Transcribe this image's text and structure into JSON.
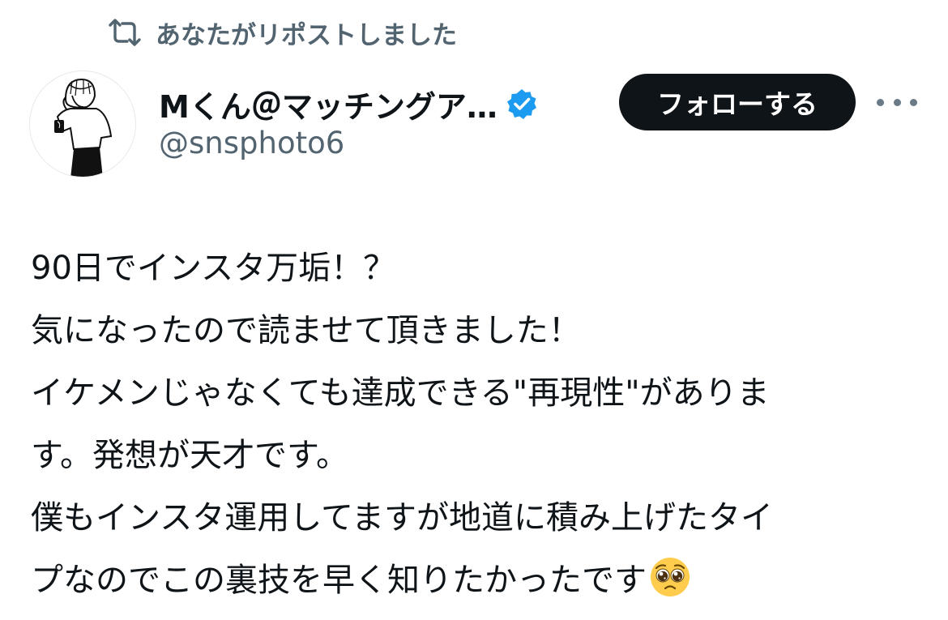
{
  "repost_header": {
    "icon": "repost-icon",
    "label": "あなたがリポストしました"
  },
  "author": {
    "avatar": "avatar-illustration",
    "display_name": "Mくん＠マッチングア…",
    "verified_icon": "verified-badge-icon",
    "handle": "@snsphoto6"
  },
  "actions": {
    "follow_label": "フォローする",
    "more_icon": "more-options-icon"
  },
  "tweet": {
    "lines": [
      "90日でインスタ万垢！？",
      "気になったので読ませて頂きました！",
      "イケメンじゃなくても達成できる\"再現性\"がありま",
      "す。発想が天才です。",
      "僕もインスタ運用してますが地道に積み上げたタイ",
      "プなのでこの裏技を早く知りたかったです"
    ],
    "trailing_emoji": "pleading-face-emoji"
  },
  "colors": {
    "text_primary": "#0f1419",
    "text_secondary": "#536471",
    "follow_bg": "#0f1419",
    "verified": "#1d9bf0"
  }
}
